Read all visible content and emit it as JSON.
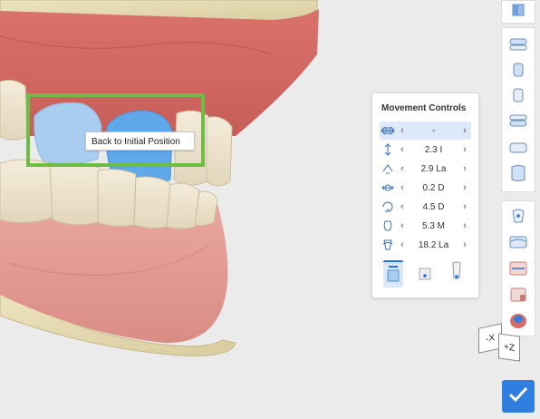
{
  "tooltip": {
    "text": "Back to Initial Position"
  },
  "movement_controls": {
    "title": "Movement Controls",
    "rows": [
      {
        "icon": "move-all-icon",
        "value": "-"
      },
      {
        "icon": "extrusion-intrusion-icon",
        "value": "2.3 I"
      },
      {
        "icon": "buccal-lingual-icon",
        "value": "2.9 La"
      },
      {
        "icon": "mesial-distal-icon",
        "value": "0.2 D"
      },
      {
        "icon": "rotation-icon",
        "value": "4.5 D"
      },
      {
        "icon": "angulation-icon",
        "value": "5.3 M"
      },
      {
        "icon": "torque-icon",
        "value": "18.2 La"
      }
    ],
    "prev_arrow": "‹",
    "next_arrow": "›"
  },
  "view_cube": {
    "face1": "-X",
    "face2": "+Z"
  },
  "colors": {
    "accent": "#2f7ee0",
    "highlight": "#6dbd45",
    "selected_tooth": "#5fa8ea",
    "selected_tooth_light": "#a9cdee"
  }
}
